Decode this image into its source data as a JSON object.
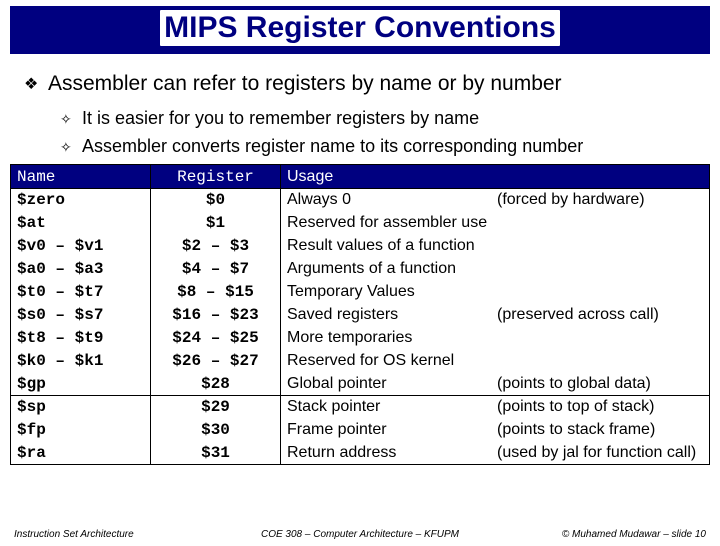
{
  "title": "MIPS Register Conventions",
  "bullets": {
    "b1": "Assembler can refer to registers by name or by number",
    "b2a": "It is easier for you to remember registers by name",
    "b2b": "Assembler converts register name to its corresponding number"
  },
  "headers": {
    "name": "Name",
    "reg": "Register",
    "usage": "Usage"
  },
  "rows": [
    {
      "name": "$zero",
      "reg": "$0",
      "usage": "Always 0",
      "note": "(forced by hardware)"
    },
    {
      "name": "$at",
      "reg": "$1",
      "usage": "Reserved for assembler use",
      "note": ""
    },
    {
      "name": "$v0 – $v1",
      "reg": "$2  –  $3",
      "usage": "Result values of a function",
      "note": ""
    },
    {
      "name": "$a0 – $a3",
      "reg": "$4  –  $7",
      "usage": "Arguments of a function",
      "note": ""
    },
    {
      "name": "$t0 – $t7",
      "reg": "$8  –  $15",
      "usage": "Temporary Values",
      "note": ""
    },
    {
      "name": "$s0 – $s7",
      "reg": "$16  –  $23",
      "usage": "Saved registers",
      "note": "(preserved across call)"
    },
    {
      "name": "$t8 – $t9",
      "reg": "$24  –  $25",
      "usage": "More temporaries",
      "note": ""
    },
    {
      "name": "$k0 – $k1",
      "reg": "$26  –  $27",
      "usage": "Reserved for OS kernel",
      "note": ""
    },
    {
      "name": "$gp",
      "reg": "$28",
      "usage": "Global pointer",
      "note": "(points to global data)"
    },
    {
      "name": "$sp",
      "reg": "$29",
      "usage": "Stack pointer",
      "note": "(points to top of stack)"
    },
    {
      "name": "$fp",
      "reg": "$30",
      "usage": "Frame pointer",
      "note": "(points to stack frame)"
    },
    {
      "name": "$ra",
      "reg": "$31",
      "usage": "Return address",
      "note": "(used by jal for function call)"
    }
  ],
  "footer": {
    "left": "Instruction Set Architecture",
    "center": "COE 308 – Computer Architecture – KFUPM",
    "right": "© Muhamed Mudawar – slide 10"
  }
}
